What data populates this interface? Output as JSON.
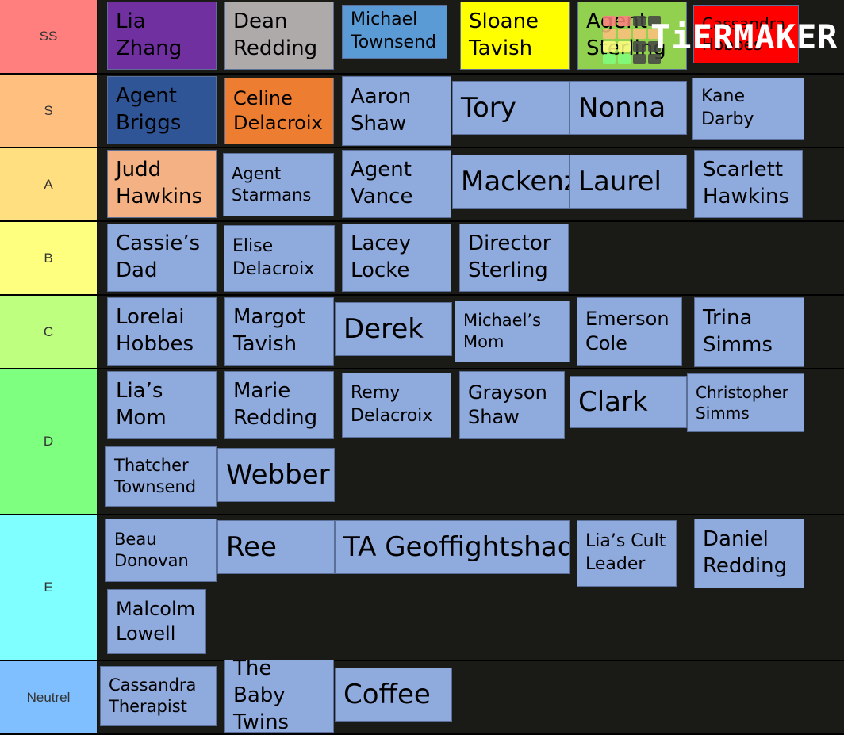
{
  "watermark": {
    "text": "TiERMAKER",
    "grid_colors": [
      "#ff7f7f",
      "#ff7f7f",
      "#444",
      "#444",
      "#ffbf7f",
      "#ffbf7f",
      "#ffbf7f",
      "#ffbf7f",
      "#ffff7f",
      "#ffff7f",
      "#444",
      "#444",
      "#7fff7f",
      "#7fff7f",
      "#444",
      "#444"
    ]
  },
  "tiers": [
    {
      "label": "SS",
      "color": "#ff7f7f",
      "items": [
        {
          "name": "Lia\nZhang",
          "color": "#7030a0"
        },
        {
          "name": "Dean\nRedding",
          "color": "#aeaaaa"
        },
        {
          "name": "Michael\nTownsend",
          "color": "#5b9bd5"
        },
        {
          "name": "Sloane\nTavish",
          "color": "#ffff00"
        },
        {
          "name": "Agent\nSterling",
          "color": "#92d050"
        },
        {
          "name": "Cassandra\nHobbes",
          "color": "#ff0000"
        }
      ]
    },
    {
      "label": "S",
      "color": "#ffbf7f",
      "items": [
        {
          "name": "Agent\nBriggs",
          "color": "#2f5597"
        },
        {
          "name": "Celine\nDelacroix",
          "color": "#ed7d31"
        },
        {
          "name": "Aaron\nShaw",
          "color": "#8faadc"
        },
        {
          "name": "Tory",
          "color": "#8faadc"
        },
        {
          "name": "Nonna",
          "color": "#8faadc"
        },
        {
          "name": "Kane\nDarby",
          "color": "#8faadc"
        }
      ]
    },
    {
      "label": "A",
      "color": "#ffdf7f",
      "items": [
        {
          "name": "Judd\nHawkins",
          "color": "#f4b183"
        },
        {
          "name": "Agent\nStarmans",
          "color": "#8faadc"
        },
        {
          "name": "Agent\nVance",
          "color": "#8faadc"
        },
        {
          "name": "Mackenzie",
          "color": "#8faadc"
        },
        {
          "name": "Laurel",
          "color": "#8faadc"
        },
        {
          "name": "Scarlett\nHawkins",
          "color": "#8faadc"
        }
      ]
    },
    {
      "label": "B",
      "color": "#ffff7f",
      "items": [
        {
          "name": "Cassie’s\nDad",
          "color": "#8faadc"
        },
        {
          "name": "Elise\nDelacroix",
          "color": "#8faadc"
        },
        {
          "name": "Lacey\nLocke",
          "color": "#8faadc"
        },
        {
          "name": "Director\nSterling",
          "color": "#8faadc"
        }
      ]
    },
    {
      "label": "C",
      "color": "#bfff7f",
      "items": [
        {
          "name": "Lorelai\nHobbes",
          "color": "#8faadc"
        },
        {
          "name": "Margot\nTavish",
          "color": "#8faadc"
        },
        {
          "name": "Derek",
          "color": "#8faadc"
        },
        {
          "name": "Michael’s\nMom",
          "color": "#8faadc"
        },
        {
          "name": "Emerson\nCole",
          "color": "#8faadc"
        },
        {
          "name": "Trina\nSimms",
          "color": "#8faadc"
        }
      ]
    },
    {
      "label": "D",
      "color": "#7fff7f",
      "items": [
        {
          "name": "Lia’s\nMom",
          "color": "#8faadc"
        },
        {
          "name": "Marie\nRedding",
          "color": "#8faadc"
        },
        {
          "name": "Remy\nDelacroix",
          "color": "#8faadc"
        },
        {
          "name": "Grayson\nShaw",
          "color": "#8faadc"
        },
        {
          "name": "Clark",
          "color": "#8faadc"
        },
        {
          "name": "Christopher\nSimms",
          "color": "#8faadc"
        },
        {
          "name": "Thatcher\nTownsend",
          "color": "#8faadc"
        },
        {
          "name": "Webber",
          "color": "#8faadc"
        }
      ]
    },
    {
      "label": "E",
      "color": "#7fffff",
      "items": [
        {
          "name": "Beau\nDonovan",
          "color": "#8faadc"
        },
        {
          "name": "Ree",
          "color": "#8faadc"
        },
        {
          "name": "TA Geoffightshad",
          "color": "#8faadc"
        },
        {
          "name": "Lia’s Cult\nLeader",
          "color": "#8faadc"
        },
        {
          "name": "Daniel\nRedding",
          "color": "#8faadc"
        },
        {
          "name": "Malcolm\nLowell",
          "color": "#8faadc"
        }
      ]
    },
    {
      "label": "Neutrel",
      "color": "#7fbfff",
      "items": [
        {
          "name": "Cassandra\nTherapist",
          "color": "#8faadc"
        },
        {
          "name": "The\nBaby\nTwins",
          "color": "#8faadc"
        },
        {
          "name": "Coffee",
          "color": "#8faadc"
        }
      ]
    }
  ]
}
